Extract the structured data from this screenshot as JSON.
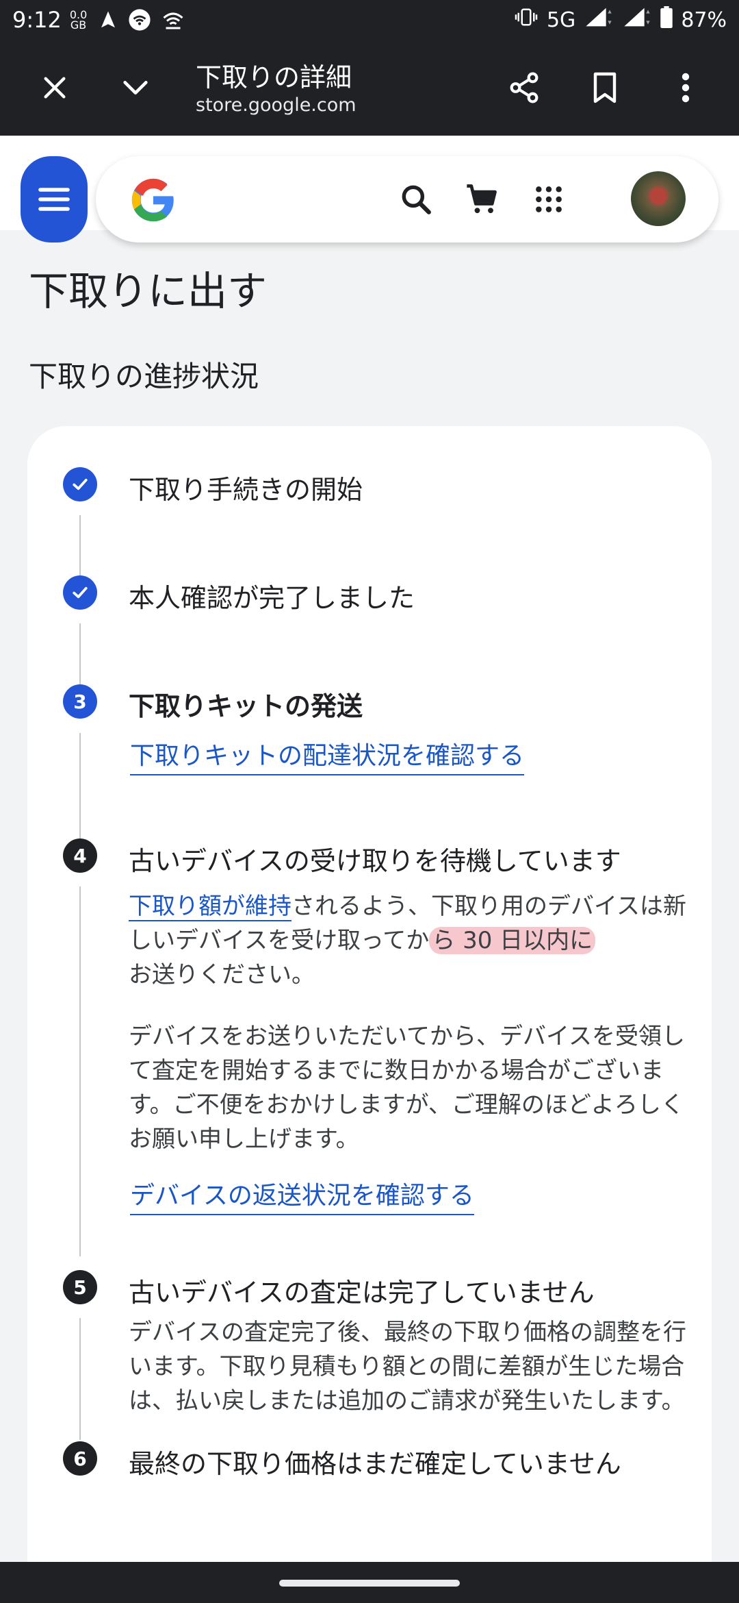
{
  "status_bar": {
    "time": "9:12",
    "data_rate_value": "0.0",
    "data_rate_unit": "GB",
    "network": "5G",
    "battery": "87%"
  },
  "browser": {
    "title": "下取りの詳細",
    "url": "store.google.com"
  },
  "page": {
    "title": "下取りに出す",
    "section_title": "下取りの進捗状況"
  },
  "steps": [
    {
      "marker": "check",
      "title": "下取り手続きの開始"
    },
    {
      "marker": "check",
      "title": "本人確認が完了しました"
    },
    {
      "marker": "3",
      "title": "下取りキットの発送",
      "link": "下取りキットの配達状況を確認する"
    },
    {
      "marker": "4",
      "title": "古いデバイスの受け取りを待機しています",
      "para1_link": "下取り額が維持",
      "para1_text_a": "されるよう、下取り用のデバイスは新しいデバイスを受け取ってか",
      "para1_highlight": "ら 30 日以内に",
      "para1_text_b": "お送りください。",
      "para2": "デバイスをお送りいただいてから、デバイスを受領して査定を開始するまでに数日かかる場合がございます。ご不便をおかけしますが、ご理解のほどよろしくお願い申し上げます。",
      "link": "デバイスの返送状況を確認する"
    },
    {
      "marker": "5",
      "title": "古いデバイスの査定は完了していません",
      "para1": "デバイスの査定完了後、最終の下取り価格の調整を行います。下取り見積もり額との間に差額が生じた場合は、払い戻しまたは追加のご請求が発生いたします。"
    },
    {
      "marker": "6",
      "title": "最終の下取り価格はまだ確定していません"
    }
  ],
  "colors": {
    "accent": "#2354d6",
    "link": "#1a56c4",
    "highlight": "#f6c7cd",
    "chrome": "#202124"
  }
}
